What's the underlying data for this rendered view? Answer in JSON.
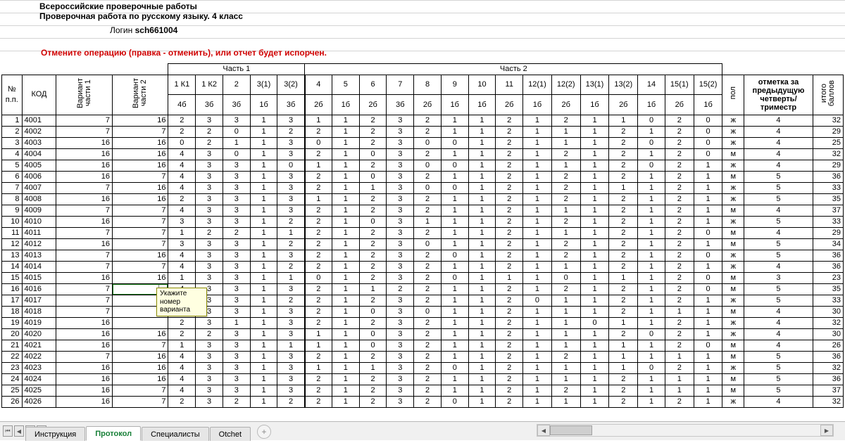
{
  "header": {
    "line1": "Всероссийские проверочные работы",
    "line2": "Проверочная работа по русскому языку. 4 класс",
    "login_label": "Логин",
    "login_value": "sch661004",
    "warning": "Отмените операцию (правка - отменить), или отчет будет испорчен."
  },
  "groups": {
    "part1": "Часть 1",
    "part2": "Часть 2"
  },
  "columns": {
    "npp_l1": "№",
    "npp_l2": "п.п.",
    "kod": "КОД",
    "var1_l1": "Вариант",
    "var1_l2": "части 1",
    "var2_l1": "Вариант",
    "var2_l2": "части 2",
    "c1k1_top": "1 К1",
    "c1k1_bot": "4б",
    "c1k2_top": "1 К2",
    "c1k2_bot": "3б",
    "c2_top": "2",
    "c2_bot": "3б",
    "c31_top": "3(1)",
    "c31_bot": "1б",
    "c32_top": "3(2)",
    "c32_bot": "3б",
    "c4_top": "4",
    "c4_bot": "2б",
    "c5_top": "5",
    "c5_bot": "1б",
    "c6_top": "6",
    "c6_bot": "2б",
    "c7_top": "7",
    "c7_bot": "3б",
    "c8_top": "8",
    "c8_bot": "2б",
    "c9_top": "9",
    "c9_bot": "1б",
    "c10_top": "10",
    "c10_bot": "1б",
    "c11_top": "11",
    "c11_bot": "2б",
    "c121_top": "12(1)",
    "c121_bot": "1б",
    "c122_top": "12(2)",
    "c122_bot": "2б",
    "c131_top": "13(1)",
    "c131_bot": "1б",
    "c132_top": "13(2)",
    "c132_bot": "2б",
    "c14_top": "14",
    "c14_bot": "1б",
    "c151_top": "15(1)",
    "c151_bot": "2б",
    "c152_top": "15(2)",
    "c152_bot": "1б",
    "pol": "пол",
    "prev_l1": "отметка за",
    "prev_l2": "предыдущую",
    "prev_l3": "четверть/",
    "prev_l4": "триместр",
    "itog_l1": "итого",
    "itog_l2": "баллов"
  },
  "rows": [
    {
      "n": "1",
      "kod": "4001",
      "v1": "7",
      "v2": "16",
      "c": [
        "2",
        "3",
        "3",
        "1",
        "3",
        "1",
        "1",
        "2",
        "3",
        "2",
        "1",
        "1",
        "2",
        "1",
        "2",
        "1",
        "1",
        "0",
        "2",
        "0"
      ],
      "pol": "ж",
      "prev": "4",
      "tot": "32"
    },
    {
      "n": "2",
      "kod": "4002",
      "v1": "7",
      "v2": "7",
      "c": [
        "2",
        "2",
        "0",
        "1",
        "2",
        "2",
        "1",
        "2",
        "3",
        "2",
        "1",
        "1",
        "2",
        "1",
        "1",
        "1",
        "2",
        "1",
        "2",
        "0"
      ],
      "pol": "ж",
      "prev": "4",
      "tot": "29"
    },
    {
      "n": "3",
      "kod": "4003",
      "v1": "16",
      "v2": "16",
      "c": [
        "0",
        "2",
        "1",
        "1",
        "3",
        "0",
        "1",
        "2",
        "3",
        "0",
        "0",
        "1",
        "2",
        "1",
        "1",
        "1",
        "2",
        "0",
        "2",
        "0"
      ],
      "pol": "ж",
      "prev": "4",
      "tot": "25"
    },
    {
      "n": "4",
      "kod": "4004",
      "v1": "16",
      "v2": "16",
      "c": [
        "4",
        "3",
        "0",
        "1",
        "3",
        "2",
        "1",
        "0",
        "3",
        "2",
        "1",
        "1",
        "2",
        "1",
        "2",
        "1",
        "2",
        "1",
        "2",
        "0"
      ],
      "pol": "м",
      "prev": "4",
      "tot": "32"
    },
    {
      "n": "5",
      "kod": "4005",
      "v1": "16",
      "v2": "16",
      "c": [
        "4",
        "3",
        "3",
        "1",
        "0",
        "1",
        "1",
        "2",
        "3",
        "0",
        "0",
        "1",
        "2",
        "1",
        "1",
        "1",
        "2",
        "0",
        "2",
        "1"
      ],
      "pol": "ж",
      "prev": "4",
      "tot": "29"
    },
    {
      "n": "6",
      "kod": "4006",
      "v1": "16",
      "v2": "7",
      "c": [
        "4",
        "3",
        "3",
        "1",
        "3",
        "2",
        "1",
        "0",
        "3",
        "2",
        "1",
        "1",
        "2",
        "1",
        "2",
        "1",
        "2",
        "1",
        "2",
        "1"
      ],
      "pol": "м",
      "prev": "5",
      "tot": "36"
    },
    {
      "n": "7",
      "kod": "4007",
      "v1": "7",
      "v2": "16",
      "c": [
        "4",
        "3",
        "3",
        "1",
        "3",
        "2",
        "1",
        "1",
        "3",
        "0",
        "0",
        "1",
        "2",
        "1",
        "2",
        "1",
        "1",
        "1",
        "2",
        "1"
      ],
      "pol": "ж",
      "prev": "5",
      "tot": "33"
    },
    {
      "n": "8",
      "kod": "4008",
      "v1": "16",
      "v2": "16",
      "c": [
        "2",
        "3",
        "3",
        "1",
        "3",
        "1",
        "1",
        "2",
        "3",
        "2",
        "1",
        "1",
        "2",
        "1",
        "2",
        "1",
        "2",
        "1",
        "2",
        "1"
      ],
      "pol": "ж",
      "prev": "5",
      "tot": "35"
    },
    {
      "n": "9",
      "kod": "4009",
      "v1": "7",
      "v2": "7",
      "c": [
        "4",
        "3",
        "3",
        "1",
        "3",
        "2",
        "1",
        "2",
        "3",
        "2",
        "1",
        "1",
        "2",
        "1",
        "1",
        "1",
        "2",
        "1",
        "2",
        "1"
      ],
      "pol": "м",
      "prev": "4",
      "tot": "37"
    },
    {
      "n": "10",
      "kod": "4010",
      "v1": "16",
      "v2": "7",
      "c": [
        "3",
        "3",
        "3",
        "1",
        "2",
        "2",
        "1",
        "0",
        "3",
        "1",
        "1",
        "1",
        "2",
        "1",
        "2",
        "1",
        "2",
        "1",
        "2",
        "1"
      ],
      "pol": "ж",
      "prev": "5",
      "tot": "33"
    },
    {
      "n": "11",
      "kod": "4011",
      "v1": "7",
      "v2": "7",
      "c": [
        "1",
        "2",
        "2",
        "1",
        "1",
        "2",
        "1",
        "2",
        "3",
        "2",
        "1",
        "1",
        "2",
        "1",
        "1",
        "1",
        "2",
        "1",
        "2",
        "0"
      ],
      "pol": "м",
      "prev": "4",
      "tot": "29"
    },
    {
      "n": "12",
      "kod": "4012",
      "v1": "16",
      "v2": "7",
      "c": [
        "3",
        "3",
        "3",
        "1",
        "2",
        "2",
        "1",
        "2",
        "3",
        "0",
        "1",
        "1",
        "2",
        "1",
        "2",
        "1",
        "2",
        "1",
        "2",
        "1"
      ],
      "pol": "м",
      "prev": "5",
      "tot": "34"
    },
    {
      "n": "13",
      "kod": "4013",
      "v1": "7",
      "v2": "16",
      "c": [
        "4",
        "3",
        "3",
        "1",
        "3",
        "2",
        "1",
        "2",
        "3",
        "2",
        "0",
        "1",
        "2",
        "1",
        "2",
        "1",
        "2",
        "1",
        "2",
        "0"
      ],
      "pol": "ж",
      "prev": "5",
      "tot": "36"
    },
    {
      "n": "14",
      "kod": "4014",
      "v1": "7",
      "v2": "7",
      "c": [
        "4",
        "3",
        "3",
        "1",
        "2",
        "2",
        "1",
        "2",
        "3",
        "2",
        "1",
        "1",
        "2",
        "1",
        "1",
        "1",
        "2",
        "1",
        "2",
        "1"
      ],
      "pol": "ж",
      "prev": "4",
      "tot": "36"
    },
    {
      "n": "15",
      "kod": "4015",
      "v1": "16",
      "v2": "16",
      "c": [
        "1",
        "3",
        "3",
        "1",
        "1",
        "0",
        "1",
        "2",
        "3",
        "2",
        "0",
        "1",
        "1",
        "1",
        "0",
        "1",
        "1",
        "1",
        "2",
        "0"
      ],
      "pol": "м",
      "prev": "3",
      "tot": "23"
    },
    {
      "n": "16",
      "kod": "4016",
      "v1": "7",
      "v2": "7",
      "c": [
        "4",
        "3",
        "3",
        "1",
        "3",
        "2",
        "1",
        "1",
        "2",
        "2",
        "1",
        "1",
        "2",
        "1",
        "2",
        "1",
        "2",
        "1",
        "2",
        "0"
      ],
      "pol": "м",
      "prev": "5",
      "tot": "35"
    },
    {
      "n": "17",
      "kod": "4017",
      "v1": "7",
      "v2": "",
      "c": [
        "2",
        "3",
        "3",
        "1",
        "2",
        "2",
        "1",
        "2",
        "3",
        "2",
        "1",
        "1",
        "2",
        "0",
        "1",
        "1",
        "2",
        "1",
        "2",
        "1"
      ],
      "pol": "ж",
      "prev": "5",
      "tot": "33"
    },
    {
      "n": "18",
      "kod": "4018",
      "v1": "7",
      "v2": "",
      "c": [
        "2",
        "3",
        "3",
        "1",
        "3",
        "2",
        "1",
        "0",
        "3",
        "0",
        "1",
        "1",
        "2",
        "1",
        "1",
        "1",
        "2",
        "1",
        "1",
        "1"
      ],
      "pol": "м",
      "prev": "4",
      "tot": "30"
    },
    {
      "n": "19",
      "kod": "4019",
      "v1": "16",
      "v2": "",
      "c": [
        "2",
        "3",
        "1",
        "1",
        "3",
        "2",
        "1",
        "2",
        "3",
        "2",
        "1",
        "1",
        "2",
        "1",
        "1",
        "0",
        "1",
        "1",
        "2",
        "1"
      ],
      "pol": "ж",
      "prev": "4",
      "tot": "32"
    },
    {
      "n": "20",
      "kod": "4020",
      "v1": "16",
      "v2": "16",
      "c": [
        "2",
        "2",
        "3",
        "1",
        "3",
        "1",
        "1",
        "0",
        "3",
        "2",
        "1",
        "1",
        "2",
        "1",
        "1",
        "1",
        "2",
        "0",
        "2",
        "1"
      ],
      "pol": "ж",
      "prev": "4",
      "tot": "30"
    },
    {
      "n": "21",
      "kod": "4021",
      "v1": "16",
      "v2": "7",
      "c": [
        "1",
        "3",
        "3",
        "1",
        "1",
        "1",
        "1",
        "0",
        "3",
        "2",
        "1",
        "1",
        "2",
        "1",
        "1",
        "1",
        "1",
        "1",
        "2",
        "0"
      ],
      "pol": "м",
      "prev": "4",
      "tot": "26"
    },
    {
      "n": "22",
      "kod": "4022",
      "v1": "7",
      "v2": "16",
      "c": [
        "4",
        "3",
        "3",
        "1",
        "3",
        "2",
        "1",
        "2",
        "3",
        "2",
        "1",
        "1",
        "2",
        "1",
        "2",
        "1",
        "1",
        "1",
        "1",
        "1"
      ],
      "pol": "м",
      "prev": "5",
      "tot": "36"
    },
    {
      "n": "23",
      "kod": "4023",
      "v1": "16",
      "v2": "16",
      "c": [
        "4",
        "3",
        "3",
        "1",
        "3",
        "1",
        "1",
        "1",
        "3",
        "2",
        "0",
        "1",
        "2",
        "1",
        "1",
        "1",
        "1",
        "0",
        "2",
        "1"
      ],
      "pol": "ж",
      "prev": "5",
      "tot": "32"
    },
    {
      "n": "24",
      "kod": "4024",
      "v1": "16",
      "v2": "16",
      "c": [
        "4",
        "3",
        "3",
        "1",
        "3",
        "2",
        "1",
        "2",
        "3",
        "2",
        "1",
        "1",
        "2",
        "1",
        "1",
        "1",
        "2",
        "1",
        "1",
        "1"
      ],
      "pol": "м",
      "prev": "5",
      "tot": "36"
    },
    {
      "n": "25",
      "kod": "4025",
      "v1": "16",
      "v2": "7",
      "c": [
        "4",
        "3",
        "3",
        "1",
        "3",
        "2",
        "1",
        "2",
        "3",
        "2",
        "1",
        "1",
        "2",
        "1",
        "2",
        "1",
        "2",
        "1",
        "1",
        "1"
      ],
      "pol": "м",
      "prev": "5",
      "tot": "37"
    },
    {
      "n": "26",
      "kod": "4026",
      "v1": "16",
      "v2": "7",
      "c": [
        "2",
        "3",
        "2",
        "1",
        "2",
        "2",
        "1",
        "2",
        "3",
        "2",
        "0",
        "1",
        "2",
        "1",
        "1",
        "1",
        "2",
        "1",
        "2",
        "1"
      ],
      "pol": "ж",
      "prev": "4",
      "tot": "32"
    }
  ],
  "tooltip": {
    "l1": "Укажите",
    "l2": "номер",
    "l3": "варианта"
  },
  "tabs": {
    "t1": "Инструкция",
    "t2": "Протокол",
    "t3": "Специалисты",
    "t4": "Otchet"
  }
}
